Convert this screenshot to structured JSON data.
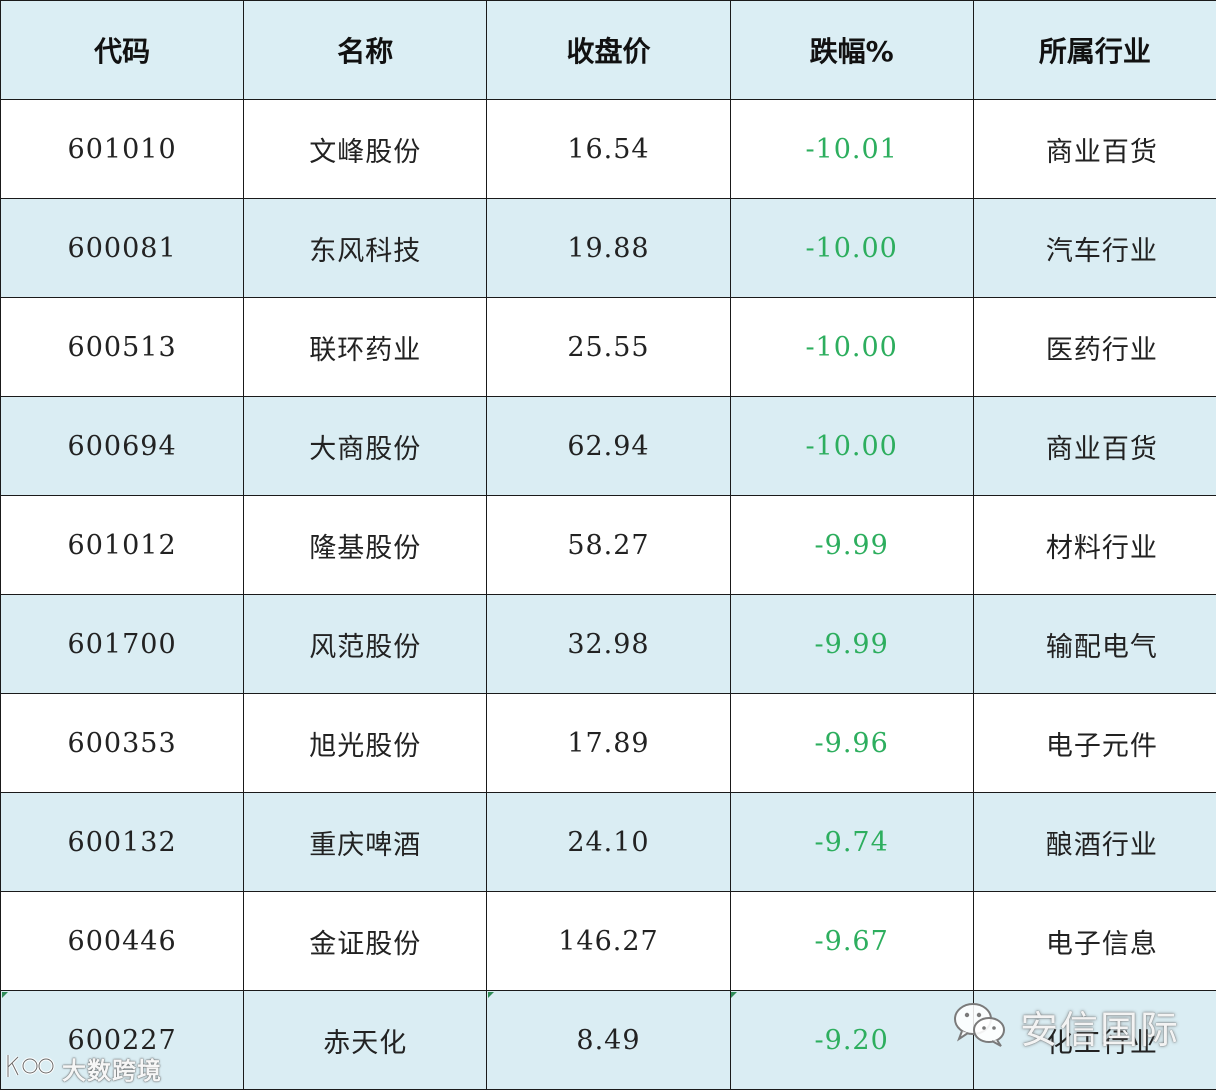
{
  "table": {
    "headers": [
      "代码",
      "名称",
      "收盘价",
      "跌幅%",
      "所属行业"
    ],
    "rows": [
      {
        "code": "601010",
        "name": "文峰股份",
        "close": "16.54",
        "change": "-10.01",
        "industry": "商业百货"
      },
      {
        "code": "600081",
        "name": "东风科技",
        "close": "19.88",
        "change": "-10.00",
        "industry": "汽车行业"
      },
      {
        "code": "600513",
        "name": "联环药业",
        "close": "25.55",
        "change": "-10.00",
        "industry": "医药行业"
      },
      {
        "code": "600694",
        "name": "大商股份",
        "close": "62.94",
        "change": "-10.00",
        "industry": "商业百货"
      },
      {
        "code": "601012",
        "name": "隆基股份",
        "close": "58.27",
        "change": "-9.99",
        "industry": "材料行业"
      },
      {
        "code": "601700",
        "name": "风范股份",
        "close": "32.98",
        "change": "-9.99",
        "industry": "输配电气"
      },
      {
        "code": "600353",
        "name": "旭光股份",
        "close": "17.89",
        "change": "-9.96",
        "industry": "电子元件"
      },
      {
        "code": "600132",
        "name": "重庆啤酒",
        "close": "24.10",
        "change": "-9.74",
        "industry": "酿酒行业"
      },
      {
        "code": "600446",
        "name": "金证股份",
        "close": "146.27",
        "change": "-9.67",
        "industry": "电子信息"
      },
      {
        "code": "600227",
        "name": "赤天化",
        "close": "8.49",
        "change": "-9.20",
        "industry": "化工行业"
      }
    ]
  },
  "watermarks": {
    "right_text": "安信国际",
    "left_text": "大数跨境",
    "right_icon": "wechat-icon",
    "left_icon": "brand-logo-icon"
  },
  "colors": {
    "header_bg": "#dbeef4",
    "stripe_bg": "#daedf3",
    "change_color": "#2dae5e",
    "border": "#1a1a1a"
  }
}
